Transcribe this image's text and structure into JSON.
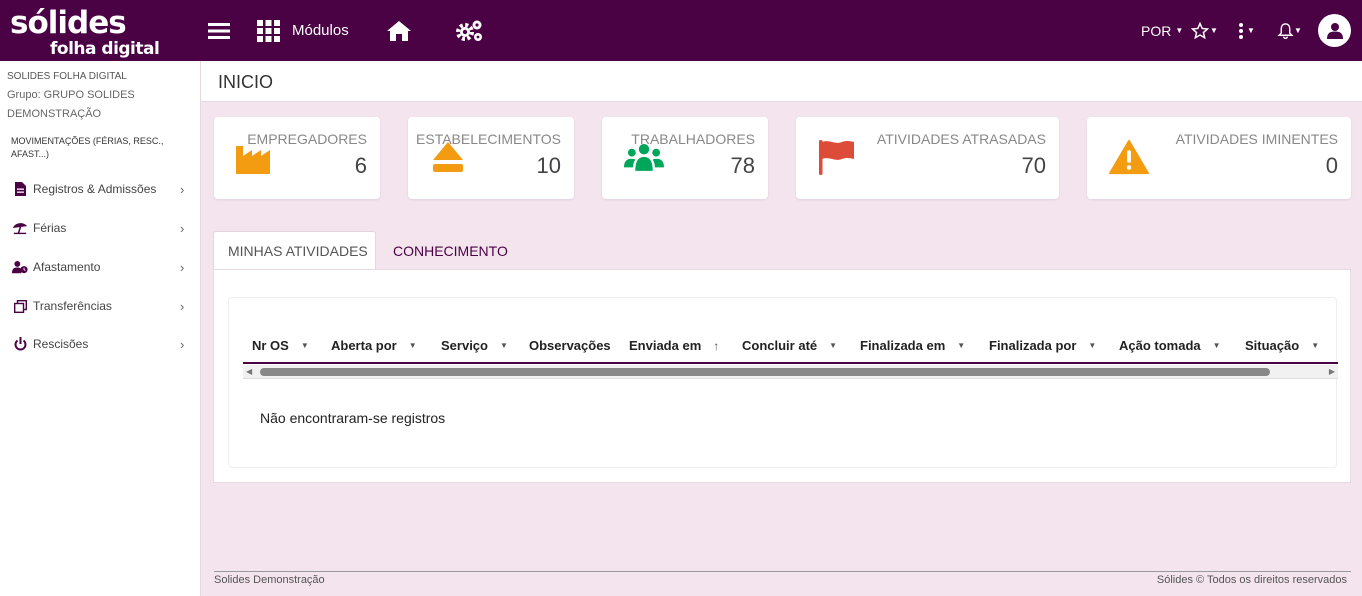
{
  "brand": {
    "main": "sólides",
    "sub": "folha digital"
  },
  "topbar": {
    "modulos_label": "Módulos",
    "language": "POR",
    "colors": {
      "bg": "#4a0245"
    }
  },
  "sidebar": {
    "company": "SOLIDES FOLHA DIGITAL",
    "group": "Grupo: GRUPO SOLIDES DEMONSTRAÇÃO",
    "movimentacoes": "MOVIMENTAÇÕES (FÉRIAS, RESC., AFAST...)",
    "items": [
      {
        "label": "Registros & Admissões",
        "icon": "file-icon"
      },
      {
        "label": "Férias",
        "icon": "beach-umbrella-icon"
      },
      {
        "label": "Afastamento",
        "icon": "user-clock-icon"
      },
      {
        "label": "Transferências",
        "icon": "clone-icon"
      },
      {
        "label": "Rescisões",
        "icon": "power-icon"
      }
    ]
  },
  "page": {
    "title": "INICIO"
  },
  "cards": [
    {
      "label": "EMPREGADORES",
      "value": "6",
      "icon": "factory-icon",
      "color": "#f39c12"
    },
    {
      "label": "ESTABELECIMENTOS",
      "value": "10",
      "icon": "eject-icon",
      "color": "#f39c12"
    },
    {
      "label": "TRABALHADORES",
      "value": "78",
      "icon": "users-icon",
      "color": "#00a65a"
    },
    {
      "label": "ATIVIDADES ATRASADAS",
      "value": "70",
      "icon": "flag-icon",
      "color": "#dd4b39"
    },
    {
      "label": "ATIVIDADES IMINENTES",
      "value": "0",
      "icon": "warning-icon",
      "color": "#f39c12"
    }
  ],
  "tabs": [
    {
      "label": "MINHAS ATIVIDADES",
      "active": true
    },
    {
      "label": "CONHECIMENTO",
      "active": false
    }
  ],
  "grid": {
    "columns": [
      {
        "label": "Nr OS",
        "sort": "caret"
      },
      {
        "label": "Aberta por",
        "sort": "caret"
      },
      {
        "label": "Serviço",
        "sort": "caret"
      },
      {
        "label": "Observações",
        "sort": ""
      },
      {
        "label": "Enviada em",
        "sort": "up"
      },
      {
        "label": "Concluir até",
        "sort": "caret"
      },
      {
        "label": "Finalizada em",
        "sort": "caret"
      },
      {
        "label": "Finalizada por",
        "sort": "caret"
      },
      {
        "label": "Ação tomada",
        "sort": "caret"
      },
      {
        "label": "Situação",
        "sort": "caret"
      }
    ],
    "empty_message": "Não encontraram-se registros"
  },
  "footer": {
    "left": "Solides Demonstração",
    "right": "Sólides © Todos os direitos reservados"
  }
}
